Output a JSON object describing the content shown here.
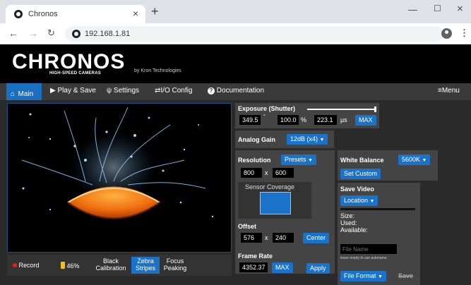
{
  "browser": {
    "tab_title": "Chronos",
    "url": "192.168.1.81"
  },
  "app": {
    "logo_text": "CHRONOS",
    "logo_sub": "HIGH-SPEED CAMERAS",
    "byline": "by Kron Technologies"
  },
  "menu": {
    "main": "Main",
    "play_save": "Play & Save",
    "settings": "Settings",
    "io_config": "I/O Config",
    "documentation": "Documentation",
    "menu": "Menu"
  },
  "bottom": {
    "record": "Record",
    "battery": "46%",
    "black_cal_1": "Black",
    "black_cal_2": "Calibration",
    "zebra_1": "Zebra",
    "zebra_2": "Stripes",
    "focus_1": "Focus",
    "focus_2": "Peaking"
  },
  "exposure": {
    "title": "Exposure (Shutter)",
    "angle": "349.5",
    "angle_unit": "°",
    "percent": "100.0",
    "percent_unit": "%",
    "time": "223.1",
    "time_unit": "µs",
    "max": "MAX"
  },
  "gain": {
    "title": "Analog Gain",
    "value": "12dB (x4)"
  },
  "resolution": {
    "title": "Resolution",
    "presets": "Presets",
    "width": "800",
    "x": "x",
    "height": "600",
    "sensor_coverage": "Sensor Coverage"
  },
  "offset": {
    "title": "Offset",
    "x_val": "576",
    "x": "x",
    "y_val": "240",
    "center": "Center"
  },
  "framerate": {
    "title": "Frame Rate",
    "value": "4352.37",
    "max": "MAX",
    "apply": "Apply"
  },
  "white_balance": {
    "title": "White Balance",
    "value": "5600K",
    "set_custom": "Set Custom"
  },
  "save_video": {
    "title": "Save Video",
    "location": "Location",
    "size": "Size:",
    "used": "Used:",
    "available": "Available:",
    "file_name_placeholder": "File Name",
    "hint": "leave empty to use autoname",
    "file_format": "File Format",
    "save": "Save"
  },
  "colors": {
    "accent": "#1a73c8",
    "panel": "#444444",
    "record_dot": "#e02020"
  }
}
